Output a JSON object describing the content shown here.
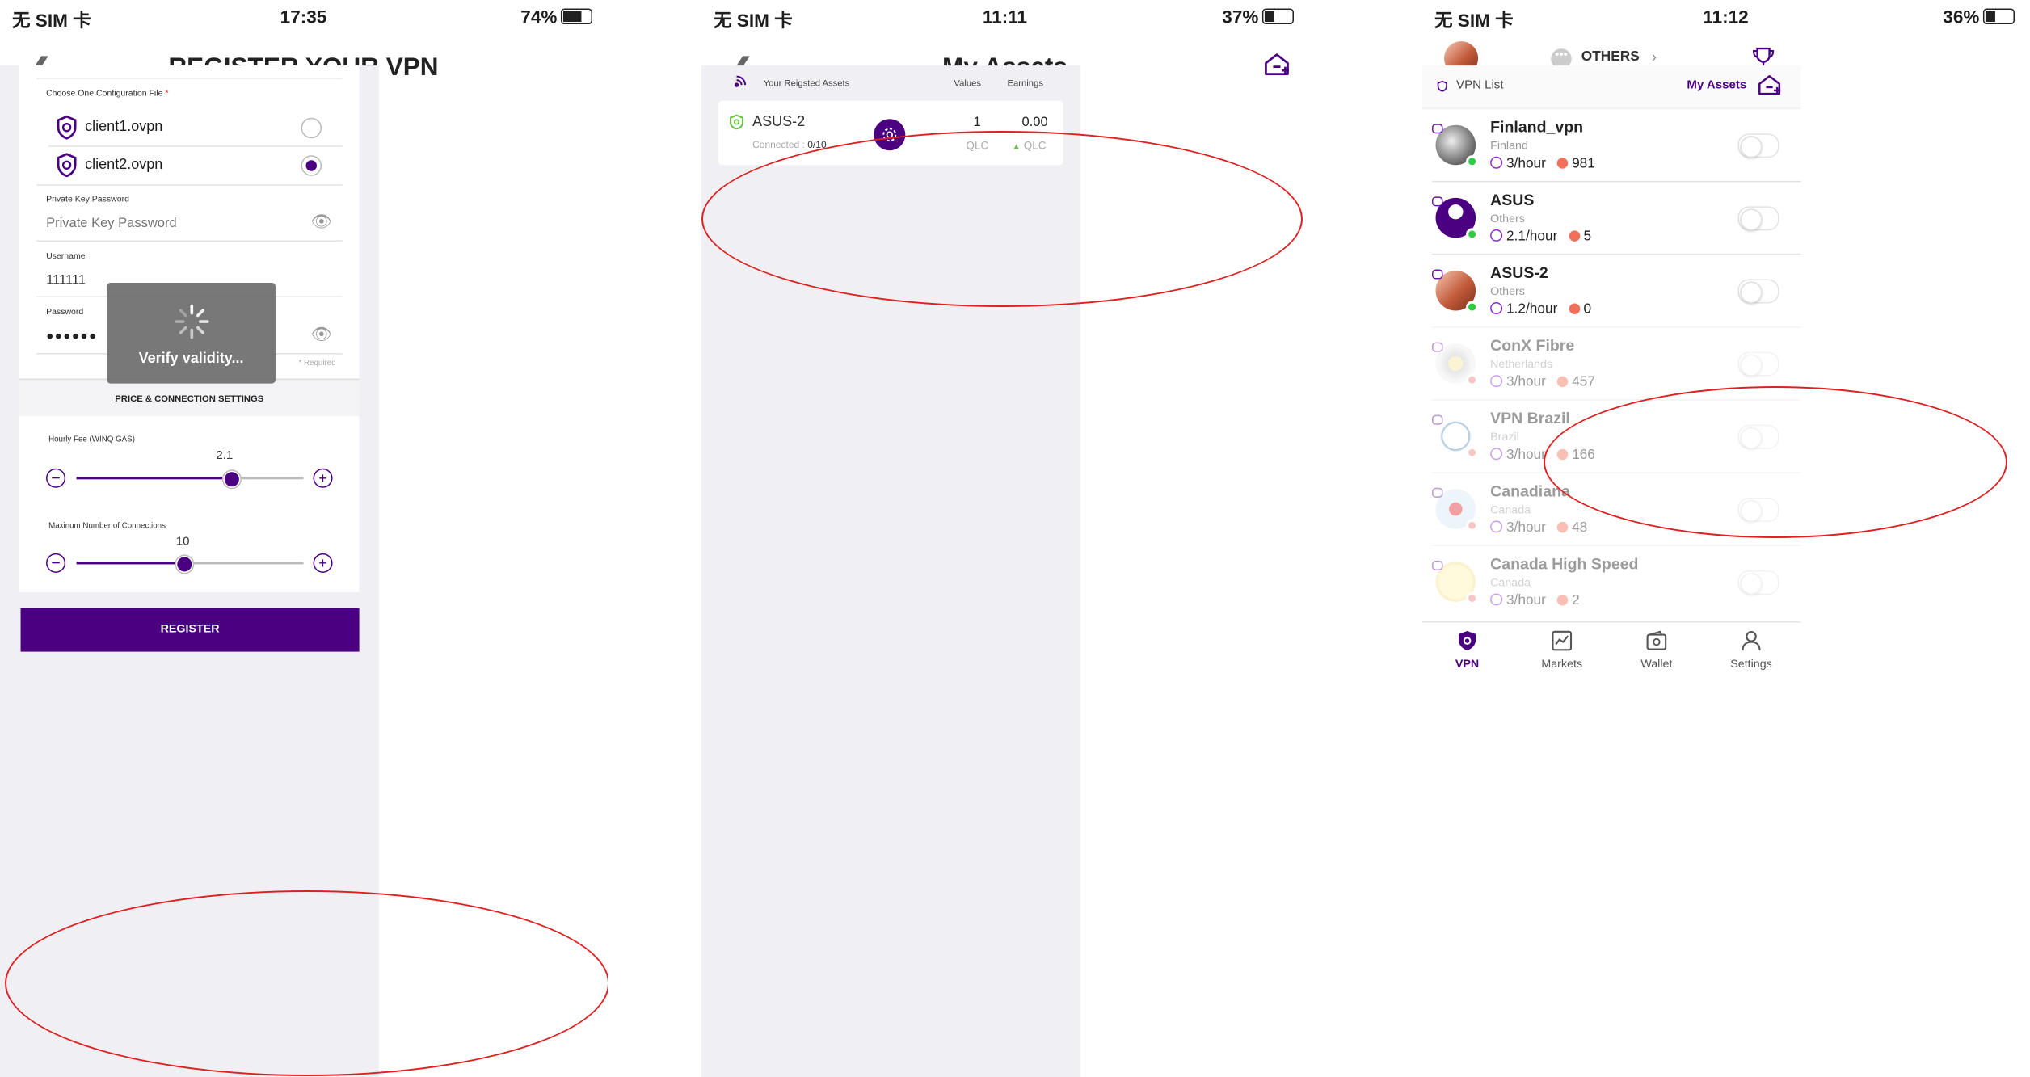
{
  "status": {
    "p1": {
      "carrier": "无 SIM 卡",
      "time": "17:35",
      "battery": "74%"
    },
    "p2": {
      "carrier": "无 SIM 卡",
      "time": "11:11",
      "battery": "37%"
    },
    "p3": {
      "carrier": "无 SIM 卡",
      "time": "11:12",
      "battery": "36%"
    }
  },
  "register": {
    "title": "REGISTER YOUR VPN",
    "config_label": "Choose One Configuration File",
    "required_star": "*",
    "files": [
      {
        "name": "client1.ovpn",
        "selected": false
      },
      {
        "name": "client2.ovpn",
        "selected": true
      }
    ],
    "private_key_label": "Private Key Password",
    "private_key_placeholder": "Private Key Password",
    "username_label": "Username",
    "username_value": "111111",
    "password_label": "Password",
    "password_value": "●●●●●●",
    "required_note": "* Required",
    "section_title": "PRICE & CONNECTION SETTINGS",
    "fee_label": "Hourly Fee (WINQ GAS)",
    "fee_value": "2.1",
    "fee_level": 0.68,
    "conn_label": "Maxinum Number of Connections",
    "conn_value": "10",
    "conn_level": 0.47,
    "register_button": "REGISTER",
    "loading_text": "Verify validity..."
  },
  "assets": {
    "title": "My Assets",
    "header_label": "Your Reigsted Assets",
    "col_values": "Values",
    "col_earnings": "Earnings",
    "item": {
      "name": "ASUS-2",
      "connected_label": "Connected :",
      "connected_value": "0/10",
      "value": "1",
      "value_unit": "QLC",
      "earnings": "0.00",
      "earnings_unit": "QLC"
    }
  },
  "vpnlist": {
    "tab_label": "OTHERS",
    "list_title": "VPN List",
    "my_assets": "My Assets",
    "items": [
      {
        "name": "Finland_vpn",
        "country": "Finland",
        "price": "3/hour",
        "likes": "981",
        "online": true,
        "active": true
      },
      {
        "name": "ASUS",
        "country": "Others",
        "price": "2.1/hour",
        "likes": "5",
        "online": true,
        "active": true
      },
      {
        "name": "ASUS-2",
        "country": "Others",
        "price": "1.2/hour",
        "likes": "0",
        "online": true,
        "active": true
      },
      {
        "name": "ConX Fibre",
        "country": "Netherlands",
        "price": "3/hour",
        "likes": "457",
        "online": false,
        "active": false
      },
      {
        "name": "VPN Brazil",
        "country": "Brazil",
        "price": "3/hour",
        "likes": "166",
        "online": false,
        "active": false
      },
      {
        "name": "Canadiana",
        "country": "Canada",
        "price": "3/hour",
        "likes": "48",
        "online": false,
        "active": false
      },
      {
        "name": "Canada High Speed",
        "country": "Canada",
        "price": "3/hour",
        "likes": "2",
        "online": false,
        "active": false
      }
    ],
    "tabs": [
      {
        "label": "VPN",
        "icon": "shield-icon",
        "active": true
      },
      {
        "label": "Markets",
        "icon": "chart-icon",
        "active": false
      },
      {
        "label": "Wallet",
        "icon": "wallet-icon",
        "active": false
      },
      {
        "label": "Settings",
        "icon": "person-icon",
        "active": false
      }
    ]
  },
  "colors": {
    "accent": "#4b0082",
    "online": "#2ecc40",
    "offline": "#f08080",
    "annotation": "#e02020",
    "like": "#f2705a"
  }
}
